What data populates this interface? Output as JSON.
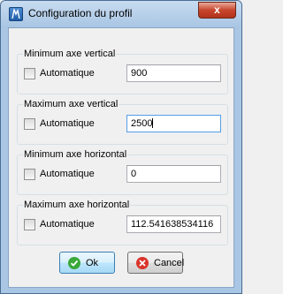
{
  "window": {
    "title": "Configuration du profil",
    "close_glyph": "x"
  },
  "groups": [
    {
      "label": "Minimum axe vertical",
      "checkbox_label": "Automatique",
      "checked": false,
      "value": "900"
    },
    {
      "label": "Maximum axe vertical",
      "checkbox_label": "Automatique",
      "checked": false,
      "value": "2500"
    },
    {
      "label": "Minimum axe horizontal",
      "checkbox_label": "Automatique",
      "checked": false,
      "value": "0"
    },
    {
      "label": "Maximum axe horizontal",
      "checkbox_label": "Automatique",
      "checked": false,
      "value": "112.541638534116"
    }
  ],
  "buttons": {
    "ok_label": "Ok",
    "cancel_label": "Cancel",
    "ok_icon": "check-circle-icon",
    "cancel_icon": "cancel-circle-icon"
  },
  "colors": {
    "titlebar": "#a8c5e3",
    "close_button": "#c7452c",
    "ok_icon": "#3aa83a",
    "cancel_icon": "#d9342b"
  }
}
